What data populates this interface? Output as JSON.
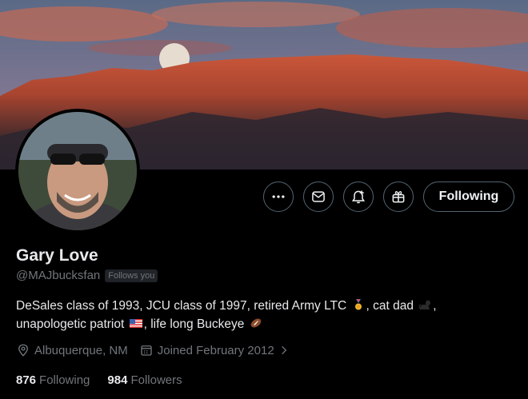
{
  "profile": {
    "name": "Gary Love",
    "handle": "@MAJbucksfan",
    "follows_you": "Follows you",
    "bio_segments": [
      "DeSales class of 1993, JCU class of 1997, retired Army LTC ",
      ", cat dad ",
      ",",
      "unapologetic patriot ",
      ", life long Buckeye "
    ],
    "location": "Albuquerque, NM",
    "joined": "Joined February 2012",
    "following_count": "876",
    "following_label": "Following",
    "followers_count": "984",
    "followers_label": "Followers"
  },
  "actions": {
    "more_icon": "more-icon",
    "message_icon": "message-icon",
    "notify_icon": "notification-bell-icon",
    "subscribe_icon": "gift-icon",
    "follow_label": "Following"
  },
  "colors": {
    "background": "#000000",
    "text_primary": "#e7e9ea",
    "text_secondary": "#71767b",
    "button_border": "#536471"
  }
}
